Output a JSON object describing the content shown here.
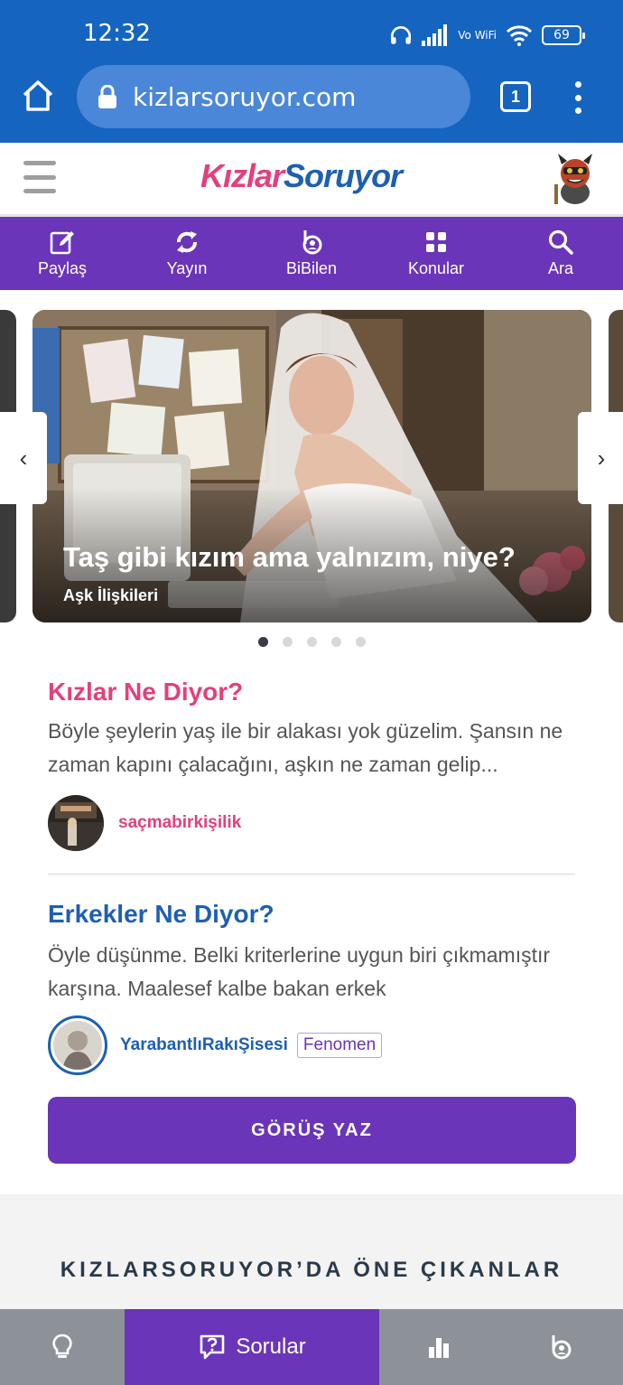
{
  "status_bar": {
    "time": "12:32",
    "network": "Vo WiFi",
    "battery": "69"
  },
  "browser": {
    "url": "kizlarsoruyor.com",
    "tab_count": "1"
  },
  "site": {
    "logo_part1": "Kızlar",
    "logo_part2": "Soruyor"
  },
  "nav": [
    {
      "label": "Paylaş",
      "icon": "edit-icon"
    },
    {
      "label": "Yayın",
      "icon": "refresh-icon"
    },
    {
      "label": "BiBilen",
      "icon": "bibilen-icon"
    },
    {
      "label": "Konular",
      "icon": "grid-icon"
    },
    {
      "label": "Ara",
      "icon": "search-icon"
    }
  ],
  "carousel": {
    "title": "Taş gibi kızım ama yalnızım, niye?",
    "category": "Aşk İlişkileri",
    "prev": "‹",
    "next": "›",
    "slide_count": 5,
    "active_index": 0
  },
  "girls": {
    "heading": "Kızlar Ne Diyor?",
    "snippet": "Böyle şeylerin yaş ile bir alakası yok güzelim. Şansın ne zaman kapını çalacağını, aşkın ne zaman gelip...",
    "author": "saçmabirkişilik"
  },
  "boys": {
    "heading": "Erkekler Ne Diyor?",
    "snippet": "Öyle düşünme. Belki kriterlerine uygun biri çıkmamıştır karşına. Maalesef kalbe bakan erkek",
    "author": "YarabantlıRakıŞisesi",
    "badge": "Fenomen"
  },
  "cta_label": "GÖRÜŞ YAZ",
  "featured_title": "KIZLARSORUYOR’DA ÖNE ÇIKANLAR",
  "bottom_nav": {
    "active_label": "Sorular",
    "items": [
      "lightbulb-icon",
      "question-icon",
      "bar-chart-icon",
      "bibilen-icon"
    ]
  },
  "colors": {
    "browser_blue": "#1565c0",
    "purple": "#6a35b8",
    "pink": "#e2407d",
    "blue": "#1e5fb3"
  }
}
